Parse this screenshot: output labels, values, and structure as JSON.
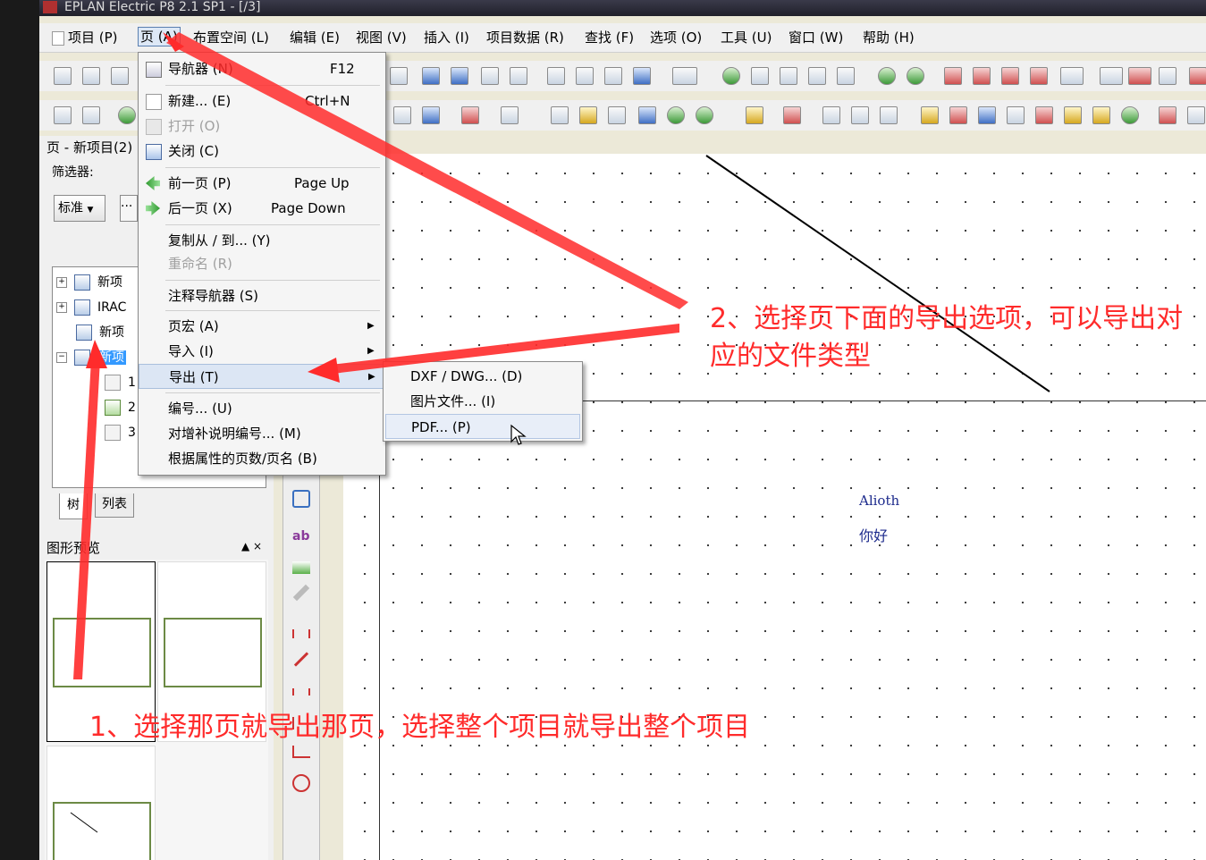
{
  "window": {
    "title": "EPLAN Electric P8 2.1 SP1 - [/3]"
  },
  "menubar": {
    "items": [
      {
        "label": "项目 (P)"
      },
      {
        "label": "页 (A)"
      },
      {
        "label": "布置空间 (L)"
      },
      {
        "label": "编辑 (E)"
      },
      {
        "label": "视图 (V)"
      },
      {
        "label": "插入 (I)"
      },
      {
        "label": "项目数据 (R)"
      },
      {
        "label": "查找 (F)"
      },
      {
        "label": "选项 (O)"
      },
      {
        "label": "工具 (U)"
      },
      {
        "label": "窗口 (W)"
      },
      {
        "label": "帮助 (H)"
      }
    ]
  },
  "page_menu": {
    "items": [
      {
        "label": "导航器 (N)",
        "shortcut": "F12",
        "icon": "navigator-icon"
      },
      {
        "label": "新建... (E)",
        "shortcut": "Ctrl+N",
        "icon": "new-page-icon"
      },
      {
        "label": "打开 (O)",
        "shortcut": "",
        "icon": "open-icon",
        "disabled": true
      },
      {
        "label": "关闭 (C)",
        "shortcut": "",
        "icon": "close-page-icon"
      },
      {
        "label": "前一页 (P)",
        "shortcut": "Page Up",
        "icon": "previous-page-icon"
      },
      {
        "label": "后一页 (X)",
        "shortcut": "Page Down",
        "icon": "next-page-icon"
      },
      {
        "label": "复制从 / 到... (Y)",
        "shortcut": ""
      },
      {
        "label": "重命名 (R)",
        "shortcut": "",
        "disabled": true
      },
      {
        "label": "注释导航器 (S)",
        "shortcut": ""
      },
      {
        "label": "页宏 (A)",
        "submenu": true
      },
      {
        "label": "导入 (I)",
        "submenu": true
      },
      {
        "label": "导出 (T)",
        "submenu": true,
        "highlighted": true
      },
      {
        "label": "编号... (U)"
      },
      {
        "label": "对增补说明编号... (M)"
      },
      {
        "label": "根据属性的页数/页名 (B)"
      }
    ]
  },
  "export_submenu": {
    "items": [
      {
        "label": "DXF / DWG... (D)"
      },
      {
        "label": "图片文件... (I)"
      },
      {
        "label": "PDF... (P)",
        "hover": true
      }
    ]
  },
  "left_panel": {
    "title": "页 - 新项目(2)",
    "filter_label": "筛选器:",
    "filter_value": "标准",
    "filter_button": "...",
    "tree": [
      {
        "label": "新项",
        "expander": "+",
        "indent": 0
      },
      {
        "label": "IRAC",
        "expander": "+",
        "indent": 0
      },
      {
        "label": "新项",
        "expander": "",
        "indent": 0
      },
      {
        "label": "新项",
        "expander": "−",
        "indent": 0,
        "selected": true
      },
      {
        "label": "1",
        "expander": "",
        "indent": 1
      },
      {
        "label": "2",
        "expander": "",
        "indent": 1
      },
      {
        "label": "3",
        "expander": "",
        "indent": 1
      }
    ],
    "tabs": {
      "tree": "树",
      "list": "列表"
    }
  },
  "preview_panel": {
    "title": "图形预览",
    "controls": "▲ ×"
  },
  "canvas": {
    "text1": "Alioth",
    "text2": "你好"
  },
  "annotations": {
    "step1": "1、选择那页就导出那页，选择整个项目就导出整个项目",
    "step2": "2、选择页下面的导出选项，可以导出对应的文件类型"
  },
  "colors": {
    "annotation": "#ff2b2b",
    "canvas_text": "#1c2a8c",
    "selection": "#3399ff"
  }
}
